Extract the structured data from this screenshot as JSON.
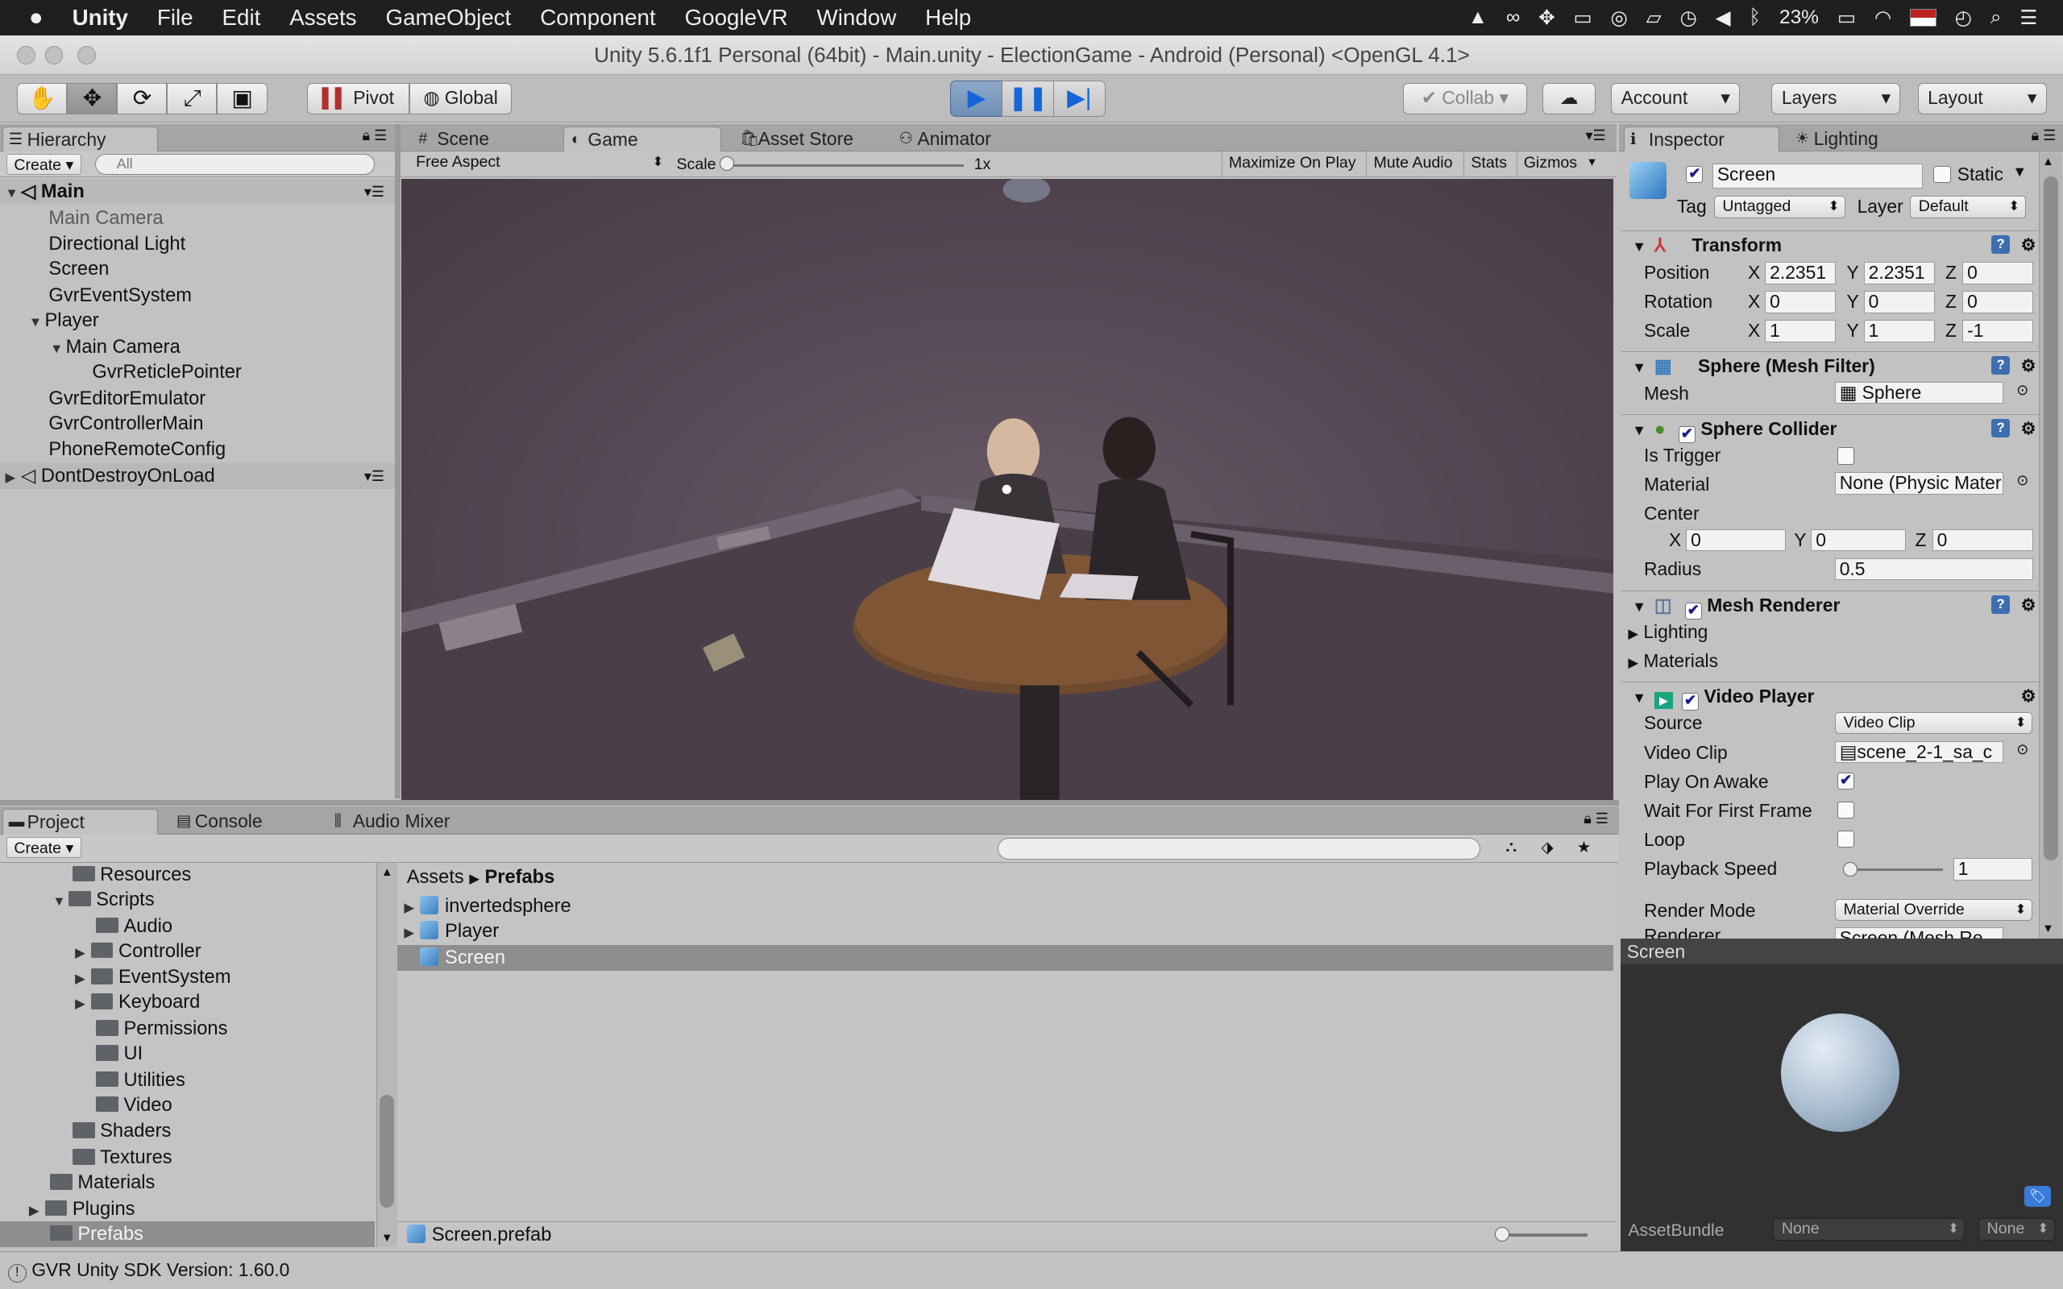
{
  "menubar": {
    "apple": "",
    "app": "Unity",
    "items": [
      "File",
      "Edit",
      "Assets",
      "GameObject",
      "Component",
      "GoogleVR",
      "Window",
      "Help"
    ],
    "battery": "23%"
  },
  "window": {
    "title": "Unity 5.6.1f1 Personal (64bit) - Main.unity - ElectionGame - Android (Personal) <OpenGL 4.1>"
  },
  "toolbar": {
    "pivot": "Pivot",
    "global": "Global",
    "collab": "Collab",
    "account": "Account",
    "layers": "Layers",
    "layout": "Layout"
  },
  "hierarchy": {
    "tab": "Hierarchy",
    "create": "Create",
    "search_placeholder": "All",
    "scene": "Main",
    "items": [
      "Main Camera",
      "Directional Light",
      "Screen",
      "GvrEventSystem",
      "Player",
      "Main Camera",
      "GvrReticlePointer",
      "GvrEditorEmulator",
      "GvrControllerMain",
      "PhoneRemoteConfig"
    ],
    "dontdestroy": "DontDestroyOnLoad"
  },
  "center": {
    "tabs": [
      "Scene",
      "Game",
      "Asset Store",
      "Animator"
    ],
    "aspect": "Free Aspect",
    "scale_label": "Scale",
    "scale_value": "1x",
    "maximize": "Maximize On Play",
    "mute": "Mute Audio",
    "stats": "Stats",
    "gizmos": "Gizmos"
  },
  "inspector": {
    "tabs": [
      "Inspector",
      "Lighting"
    ],
    "name": "Screen",
    "static": "Static",
    "tag_label": "Tag",
    "tag": "Untagged",
    "layer_label": "Layer",
    "layer": "Default",
    "transform": {
      "title": "Transform",
      "position": "Position",
      "rotation": "Rotation",
      "scale": "Scale",
      "px": "2.2351",
      "py": "2.2351",
      "pz": "0",
      "rx": "0",
      "ry": "0",
      "rz": "0",
      "sx": "1",
      "sy": "1",
      "sz": "-1",
      "X": "X",
      "Y": "Y",
      "Z": "Z"
    },
    "meshfilter": {
      "title": "Sphere (Mesh Filter)",
      "mesh_label": "Mesh",
      "mesh": "Sphere"
    },
    "collider": {
      "title": "Sphere Collider",
      "is_trigger": "Is Trigger",
      "material_label": "Material",
      "material": "None (Physic Mater",
      "center": "Center",
      "cx": "0",
      "cy": "0",
      "cz": "0",
      "radius_label": "Radius",
      "radius": "0.5"
    },
    "renderer": {
      "title": "Mesh Renderer",
      "lighting": "Lighting",
      "materials": "Materials"
    },
    "video": {
      "title": "Video Player",
      "source_label": "Source",
      "source": "Video Clip",
      "clip_label": "Video Clip",
      "clip": "scene_2-1_sa_c",
      "play_on_awake": "Play On Awake",
      "wait": "Wait For First Frame",
      "loop": "Loop",
      "speed_label": "Playback Speed",
      "speed": "1",
      "render_mode_label": "Render Mode",
      "render_mode": "Material Override",
      "renderer_label": "Renderer",
      "renderer_value": "Screen (Mesh Re"
    },
    "preview": {
      "title": "Screen",
      "assetbundle": "AssetBundle",
      "bundle_value": "None",
      "variant_value": "None"
    }
  },
  "project": {
    "tabs": [
      "Project",
      "Console",
      "Audio Mixer"
    ],
    "create": "Create",
    "tree": [
      "Resources",
      "Scripts",
      "Audio",
      "Controller",
      "EventSystem",
      "Keyboard",
      "Permissions",
      "UI",
      "Utilities",
      "Video",
      "Shaders",
      "Textures",
      "Materials",
      "Plugins",
      "Prefabs"
    ],
    "breadcrumb": [
      "Assets",
      "Prefabs"
    ],
    "assets": [
      "invertedsphere",
      "Player",
      "Screen"
    ],
    "selected_file": "Screen.prefab"
  },
  "status": {
    "text": "GVR Unity SDK Version: 1.60.0"
  }
}
